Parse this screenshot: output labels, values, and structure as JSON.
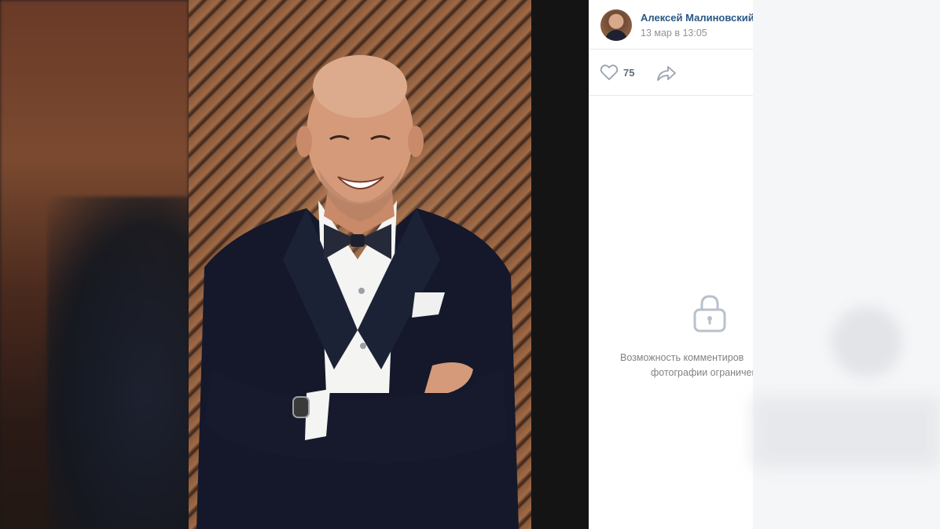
{
  "post": {
    "author": "Алексей Малиновский",
    "date": "13 мар в 13:05"
  },
  "actions": {
    "like_count": "75",
    "like_icon": "heart-icon",
    "share_icon": "share-arrow-icon"
  },
  "comments": {
    "lock_icon": "lock-icon",
    "notice_line1": "Возможность комментиров",
    "notice_line2": "фотографии ограничен"
  },
  "colors": {
    "author_link": "#2a5885",
    "muted_text": "#939393",
    "icon_gray": "#99a2ad"
  }
}
